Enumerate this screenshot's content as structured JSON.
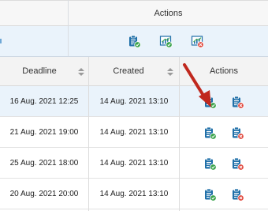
{
  "top_panel": {
    "actions_header": "Actions",
    "icons": [
      "create-report-icon",
      "chart-report-icon",
      "delete-chart-report-icon"
    ]
  },
  "grid": {
    "columns": {
      "deadline": "Deadline",
      "created": "Created",
      "actions": "Actions"
    },
    "rows": [
      {
        "deadline": "16 Aug. 2021 12:25",
        "created": "14 Aug. 2021 13:10",
        "selected": true
      },
      {
        "deadline": "21 Aug. 2021 19:00",
        "created": "14 Aug. 2021 13:10",
        "selected": false
      },
      {
        "deadline": "25 Aug. 2021 18:00",
        "created": "14 Aug. 2021 13:10",
        "selected": false
      },
      {
        "deadline": "20 Aug. 2021 20:00",
        "created": "14 Aug. 2021 13:10",
        "selected": false
      }
    ],
    "row_action_icons": [
      "approve-clipboard-icon",
      "reject-clipboard-icon"
    ]
  },
  "colors": {
    "accent_blue": "#1f6fa8",
    "selection": "#eaf3fb",
    "approve_green": "#3aa34a",
    "reject_red": "#e0453a",
    "annotation_arrow": "#c0281e"
  }
}
